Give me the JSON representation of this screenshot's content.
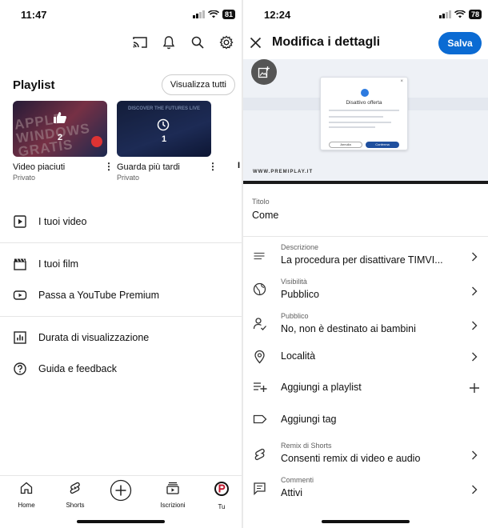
{
  "left": {
    "status": {
      "time": "11:47",
      "battery": "81"
    },
    "header_icons": [
      "cast-icon",
      "bell-icon",
      "search-icon",
      "gear-icon"
    ],
    "playlist": {
      "title": "Playlist",
      "view_all": "Visualizza tutti",
      "cards": [
        {
          "title": "Video piaciuti",
          "privacy": "Privato",
          "count": "2",
          "thumb_text": "APPLE WINDOWS GRATIS"
        },
        {
          "title": "Guarda più tardi",
          "privacy": "Privato",
          "count": "1",
          "thumb_text": "DISCOVER THE FUTURES LIVE"
        }
      ]
    },
    "menu": [
      {
        "label": "I tuoi video",
        "icon": "play-square-icon"
      },
      {
        "label": "I tuoi film",
        "icon": "clapper-icon"
      },
      {
        "label": "Passa a YouTube Premium",
        "icon": "youtube-icon"
      },
      {
        "label": "Durata di visualizzazione",
        "icon": "chart-icon"
      },
      {
        "label": "Guida e feedback",
        "icon": "help-icon"
      }
    ],
    "nav": [
      {
        "label": "Home",
        "icon": "home-icon"
      },
      {
        "label": "Shorts",
        "icon": "shorts-icon"
      },
      {
        "label": "",
        "icon": "create-icon"
      },
      {
        "label": "Iscrizioni",
        "icon": "subscriptions-icon"
      },
      {
        "label": "Tu",
        "icon": "avatar-icon"
      }
    ]
  },
  "right": {
    "status": {
      "time": "12:24",
      "battery": "78"
    },
    "title": "Modifica i dettagli",
    "save": "Salva",
    "preview": {
      "dialog_title": "Disattivo offerta",
      "cancel": "Annulla",
      "confirm": "Conferma",
      "watermark": "WWW.PREMIPLAY.IT"
    },
    "title_field": {
      "label": "Titolo",
      "value": "Come"
    },
    "rows": [
      {
        "label": "Descrizione",
        "value": "La procedura per disattivare TIMVI...",
        "icon": "description-icon",
        "action": "chevron"
      },
      {
        "label": "Visibilità",
        "value": "Pubblico",
        "icon": "globe-icon",
        "action": "chevron"
      },
      {
        "label": "Pubblico",
        "value": "No, non è destinato ai bambini",
        "icon": "audience-icon",
        "action": "chevron"
      },
      {
        "label": "",
        "value": "Località",
        "icon": "location-icon",
        "action": "chevron"
      },
      {
        "label": "",
        "value": "Aggiungi a playlist",
        "icon": "playlist-add-icon",
        "action": "plus"
      },
      {
        "label": "",
        "value": "Aggiungi tag",
        "icon": "tag-icon",
        "action": "none"
      },
      {
        "label": "Remix di Shorts",
        "value": "Consenti remix di video e audio",
        "icon": "shorts-remix-icon",
        "action": "chevron"
      },
      {
        "label": "Commenti",
        "value": "Attivi",
        "icon": "comment-icon",
        "action": "chevron"
      }
    ]
  }
}
